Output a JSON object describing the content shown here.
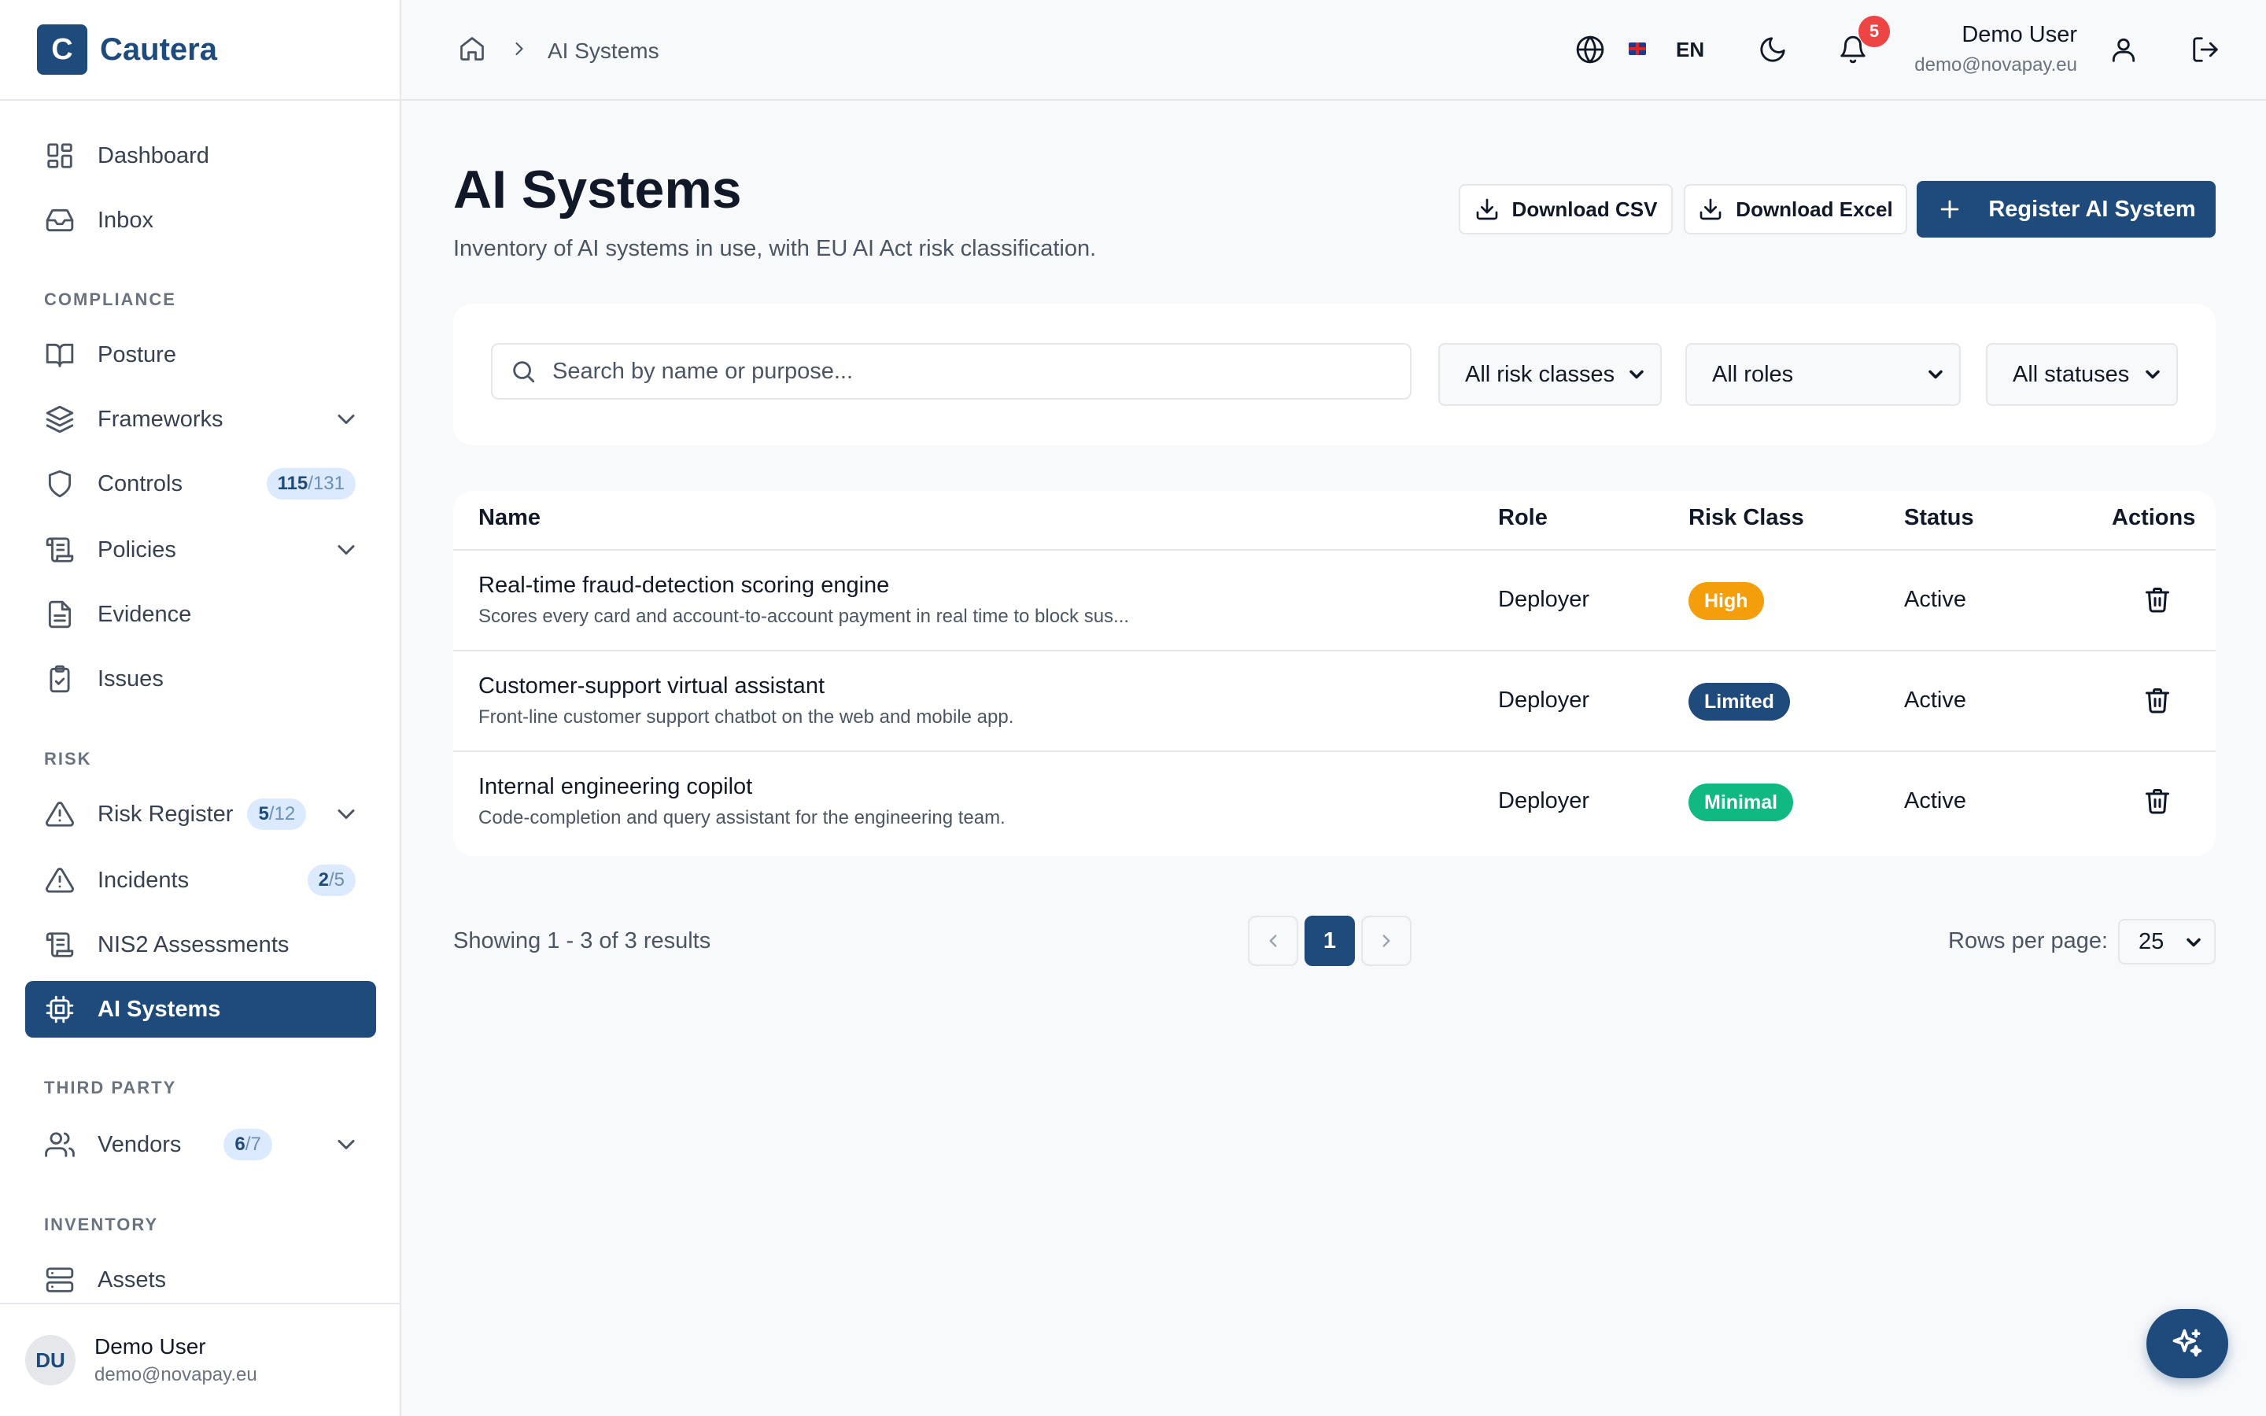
{
  "brand": {
    "logo_letter": "C",
    "name": "Cautera",
    "color": "#1e4a7c"
  },
  "sidebar": {
    "sections": {
      "compliance": "COMPLIANCE",
      "risk": "RISK",
      "third_party": "THIRD PARTY",
      "inventory": "INVENTORY"
    },
    "items": {
      "dashboard": {
        "label": "Dashboard",
        "icon": "dashboard-icon"
      },
      "inbox": {
        "label": "Inbox",
        "icon": "inbox-icon"
      },
      "posture": {
        "label": "Posture",
        "icon": "book-icon"
      },
      "frameworks": {
        "label": "Frameworks",
        "icon": "layers-icon"
      },
      "controls": {
        "label": "Controls",
        "icon": "shield-icon",
        "badge_main": "115",
        "badge_sub": "/131"
      },
      "policies": {
        "label": "Policies",
        "icon": "scroll-icon"
      },
      "evidence": {
        "label": "Evidence",
        "icon": "file-icon"
      },
      "issues": {
        "label": "Issues",
        "icon": "clipboard-check-icon"
      },
      "risk_register": {
        "label": "Risk Register",
        "icon": "warning-icon",
        "badge_main": "5",
        "badge_sub": "/12"
      },
      "incidents": {
        "label": "Incidents",
        "icon": "warning-icon",
        "badge_main": "2",
        "badge_sub": "/5"
      },
      "nis2": {
        "label": "NIS2 Assessments",
        "icon": "scroll-icon"
      },
      "ai_systems": {
        "label": "AI Systems",
        "icon": "cpu-icon",
        "active": true
      },
      "vendors": {
        "label": "Vendors",
        "icon": "users-icon",
        "badge_main": "6",
        "badge_sub": "/7"
      },
      "assets": {
        "label": "Assets",
        "icon": "server-icon"
      }
    },
    "user": {
      "initials": "DU",
      "name": "Demo User",
      "email": "demo@novapay.eu"
    }
  },
  "topbar": {
    "breadcrumb": {
      "home_icon": "home-icon",
      "current": "AI Systems"
    },
    "language": "EN",
    "notifications": "5",
    "user": {
      "name": "Demo User",
      "email": "demo@novapay.eu"
    }
  },
  "page": {
    "title": "AI Systems",
    "subtitle": "Inventory of AI systems in use, with EU AI Act risk classification.",
    "buttons": {
      "download_csv": "Download CSV",
      "download_excel": "Download Excel",
      "register": "Register AI System"
    }
  },
  "filters": {
    "search_placeholder": "Search by name or purpose...",
    "risk_class": "All risk classes",
    "role": "All roles",
    "status": "All statuses"
  },
  "table": {
    "headers": {
      "name": "Name",
      "role": "Role",
      "risk_class": "Risk Class",
      "status": "Status",
      "actions": "Actions"
    },
    "rows": [
      {
        "name": "Real-time fraud-detection scoring engine",
        "description": "Scores every card and account-to-account payment in real time to block sus...",
        "role": "Deployer",
        "risk": "High",
        "risk_color": "#f59e0b",
        "status": "Active"
      },
      {
        "name": "Customer-support virtual assistant",
        "description": "Front-line customer support chatbot on the web and mobile app.",
        "role": "Deployer",
        "risk": "Limited",
        "risk_color": "#1e4a7c",
        "status": "Active"
      },
      {
        "name": "Internal engineering copilot",
        "description": "Code-completion and query assistant for the engineering team.",
        "role": "Deployer",
        "risk": "Minimal",
        "risk_color": "#10b981",
        "status": "Active"
      }
    ]
  },
  "pagination": {
    "summary": "Showing 1 - 3 of 3 results",
    "current_page": "1",
    "rows_per_page_label": "Rows per page:",
    "rows_per_page": "25"
  },
  "fab": {
    "icon": "sparkles-icon"
  }
}
